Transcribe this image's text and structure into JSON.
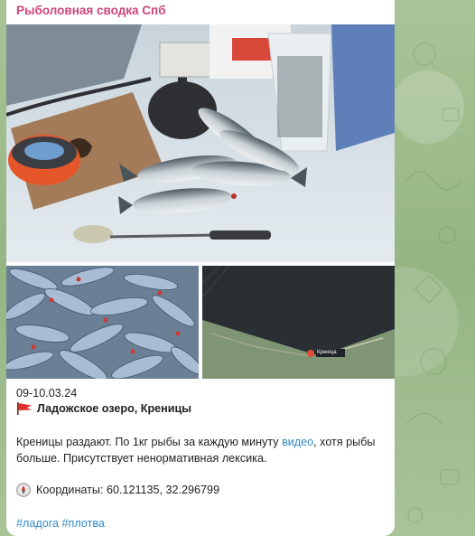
{
  "channel": {
    "name": "Рыболовная сводка Спб"
  },
  "post": {
    "date": "09-10.03.24",
    "location": "Ладожское озеро, Креницы",
    "text_before_link": "Креницы раздают. По 1кг рыбы за каждую минуту ",
    "link_text": "видео",
    "text_after_link": ", хотя рыбы больше. Присутствует ненормативная лексика.",
    "coordinates_label": "Координаты: 60.121135, 32.296799",
    "hashtags": [
      "#ладога",
      "#плотва"
    ]
  },
  "map": {
    "place_label": "Кренiца"
  },
  "colors": {
    "channel_name": "#d0457a",
    "link": "#2f8bc8",
    "flag": "#e0302c"
  }
}
